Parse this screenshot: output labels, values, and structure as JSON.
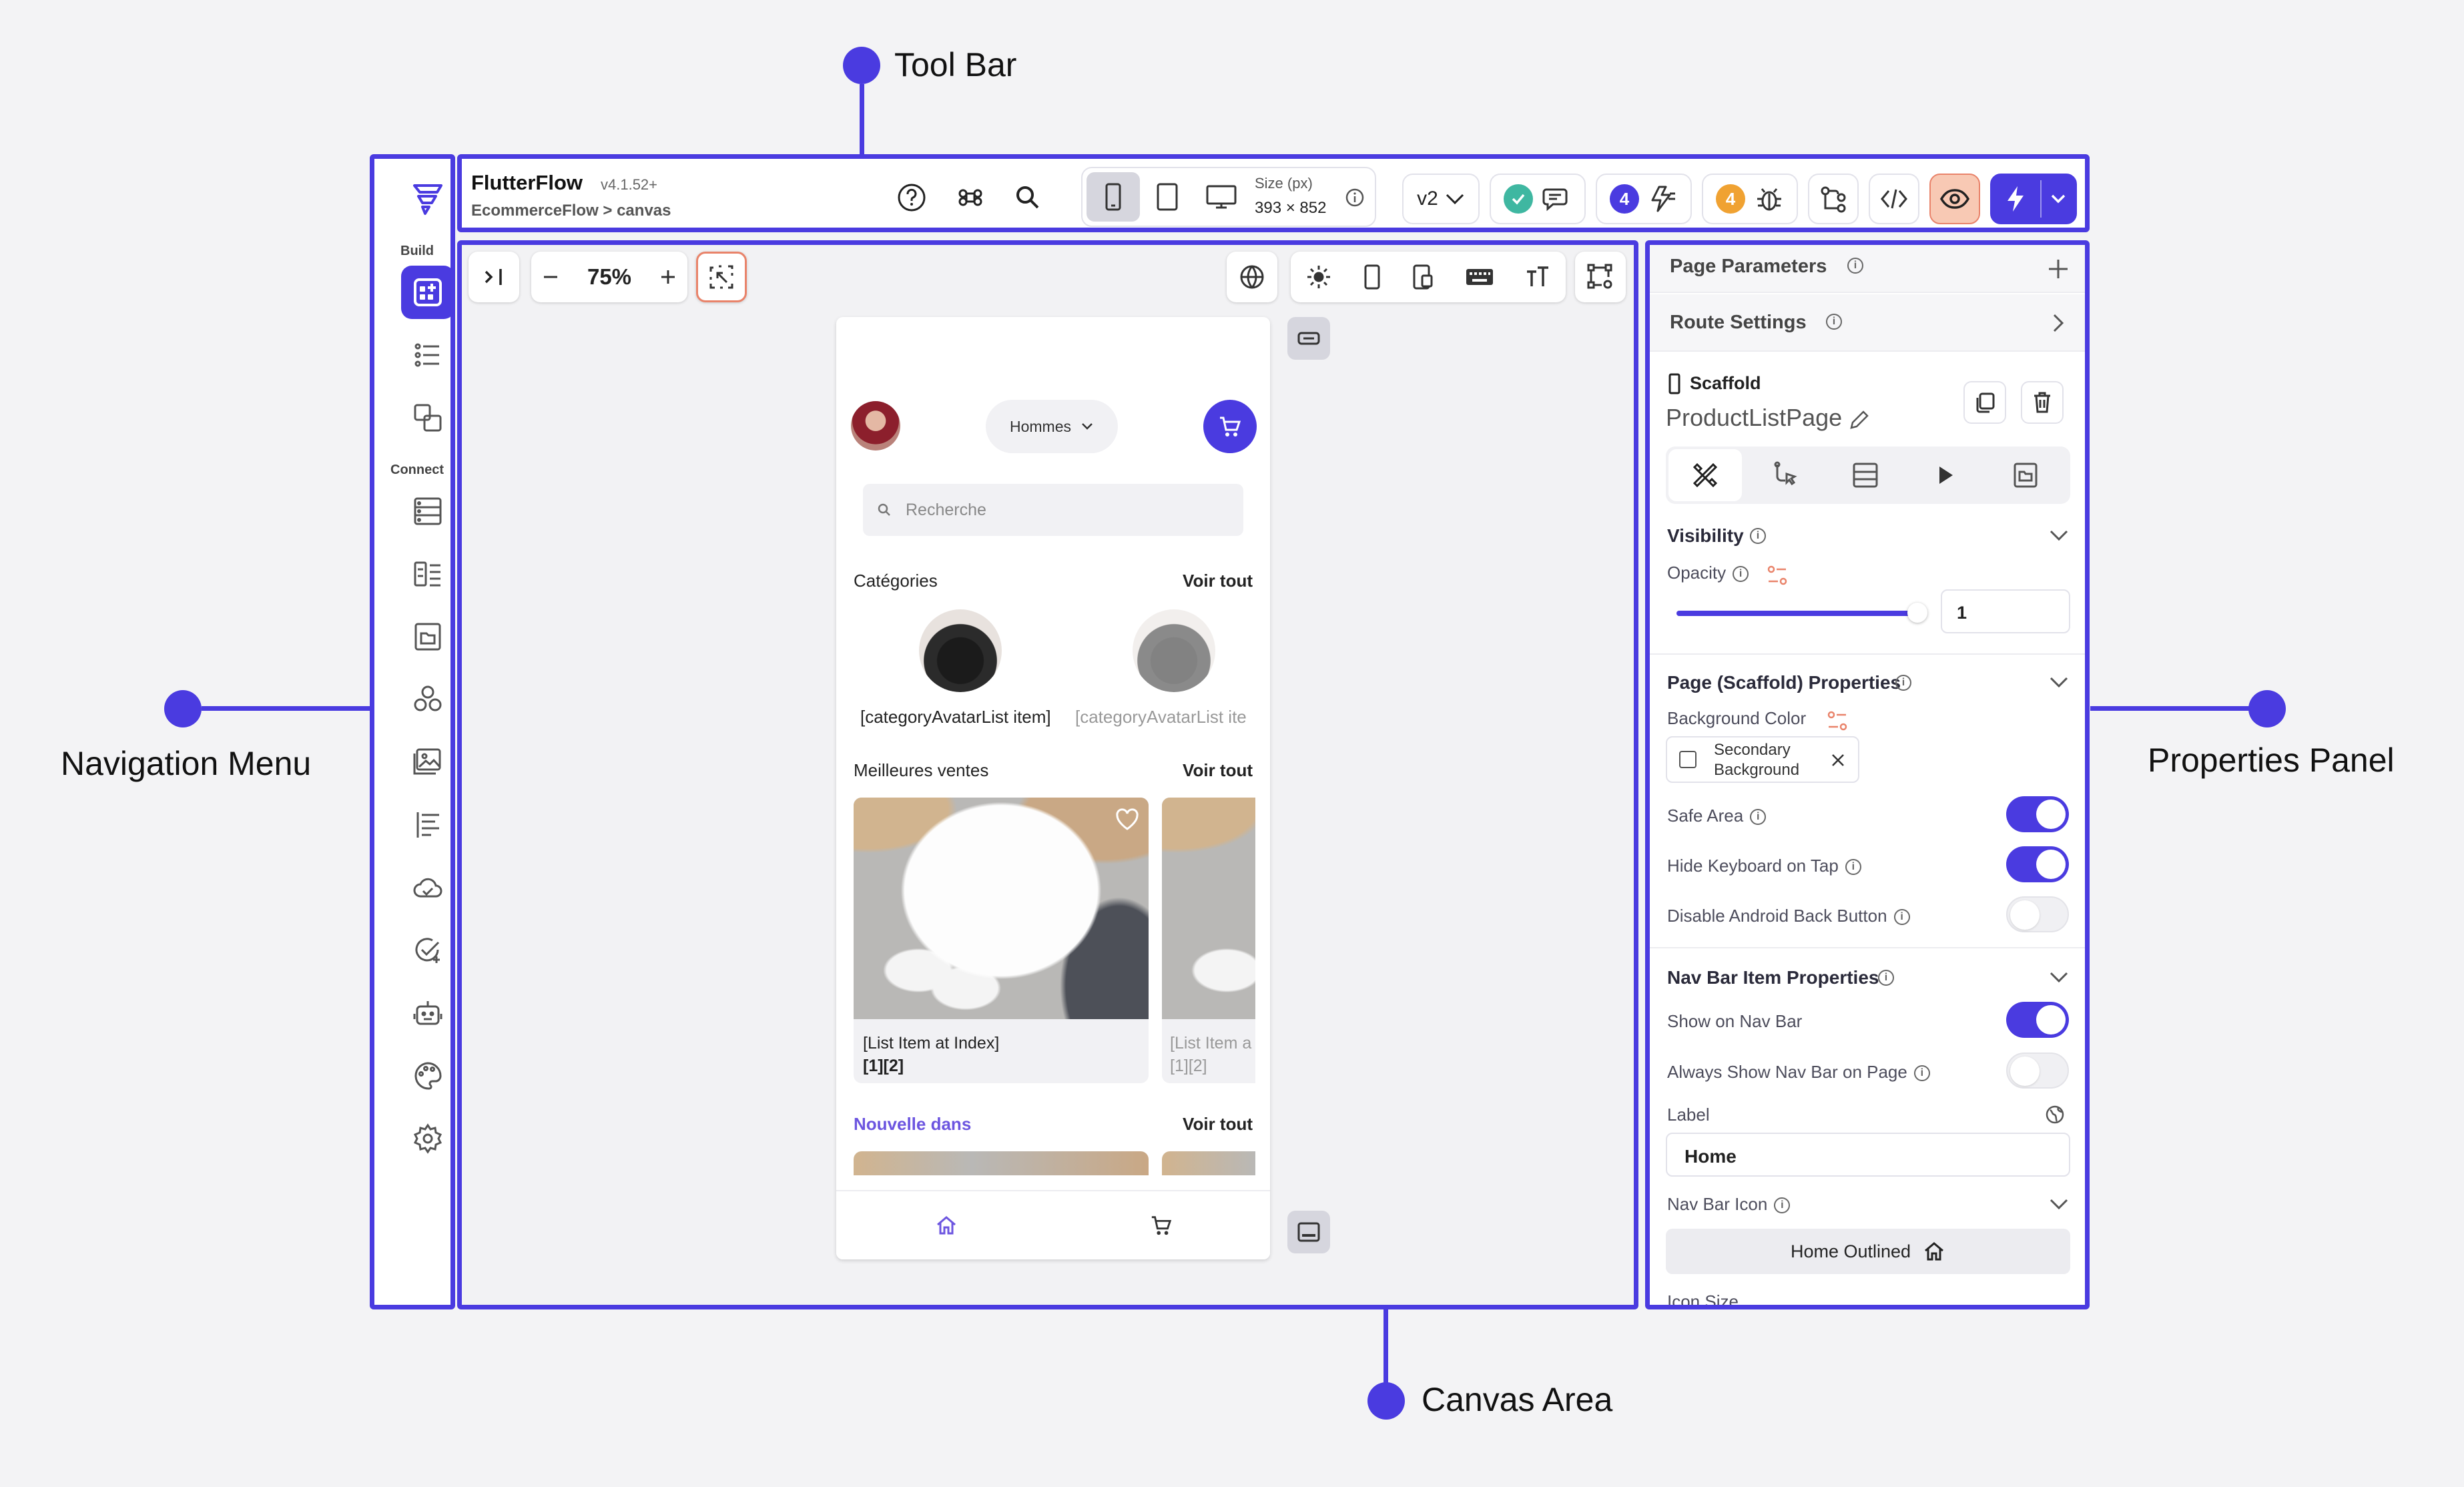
{
  "callouts": {
    "toolbar": "Tool Bar",
    "navigation": "Navigation Menu",
    "properties": "Properties Panel",
    "canvas": "Canvas Area"
  },
  "colors": {
    "accent": "#4a3be0",
    "toggle_off": "#f0f0f3"
  },
  "app": {
    "name": "FlutterFlow",
    "version": "v4.1.52+",
    "breadcrumb": "EcommerceFlow > canvas"
  },
  "nav": {
    "build_label": "Build",
    "connect_label": "Connect",
    "icons": [
      "widget-tree-icon",
      "list-icon",
      "components-icon",
      "database-icon",
      "schema-icon",
      "files-icon",
      "integrations-icon",
      "media-icon",
      "text-icon",
      "cloud-icon",
      "tests-icon",
      "agent-icon",
      "theme-icon",
      "settings-icon"
    ]
  },
  "toolbar": {
    "size_label": "Size (px)",
    "size_value": "393 × 852",
    "version_select": "v2",
    "warnings_count": "4",
    "errors_count": "4"
  },
  "canvas": {
    "zoom": "75%",
    "device": {
      "gender_select": "Hommes",
      "search_placeholder": "Recherche",
      "categories_title": "Catégories",
      "see_all": "Voir tout",
      "category_items": [
        "[categoryAvatarList item]",
        "[categoryAvatarList ite"
      ],
      "bestsellers_title": "Meilleures ventes",
      "product_cards": [
        {
          "title": "[List Item at Index]",
          "sub": "[1][2]"
        },
        {
          "title": "[List Item a",
          "sub": "[1][2]"
        }
      ],
      "new_title": "Nouvelle dans"
    }
  },
  "properties": {
    "page_parameters": "Page Parameters",
    "route_settings": "Route Settings",
    "widget_type": "Scaffold",
    "widget_name": "ProductListPage",
    "visibility": "Visibility",
    "opacity_label": "Opacity",
    "opacity_value": "1",
    "opacity_level": 0.97,
    "scaffold_props": "Page (Scaffold) Properties",
    "background_color_label": "Background Color",
    "background_color_value": "Secondary Background",
    "safe_area": "Safe Area",
    "hide_keyboard": "Hide Keyboard on Tap",
    "disable_back": "Disable Android Back Button",
    "navbar_props": "Nav Bar Item Properties",
    "show_on_navbar": "Show on Nav Bar",
    "always_show_navbar": "Always Show Nav Bar on Page",
    "label_label": "Label",
    "label_value": "Home",
    "navbar_icon": "Nav Bar Icon",
    "icon_value": "Home Outlined",
    "icon_size": "Icon Size"
  }
}
